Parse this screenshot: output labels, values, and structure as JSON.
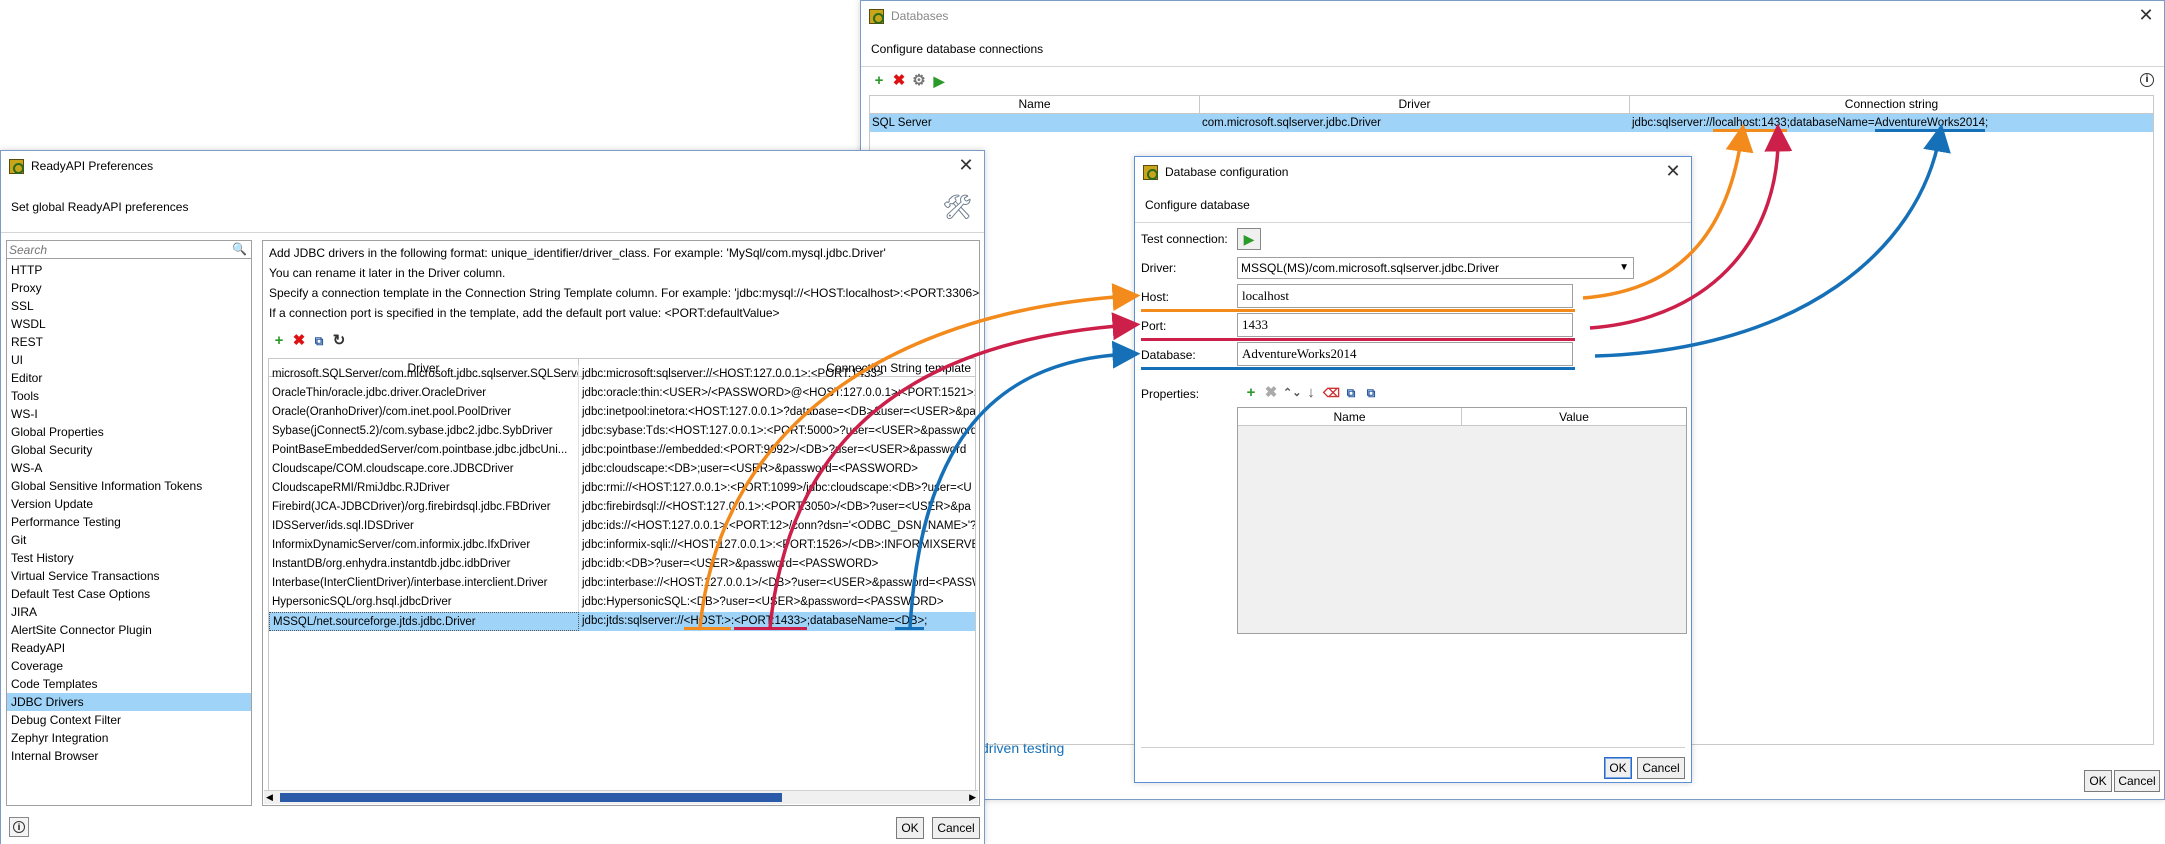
{
  "colors": {
    "orange": "#f28a1c",
    "red": "#cc1f4a",
    "blue": "#1570b8",
    "selection": "#9fd3f8"
  },
  "databases": {
    "title": "Databases",
    "subtitle": "Configure database connections",
    "columns": [
      "Name",
      "Driver",
      "Connection string"
    ],
    "row": {
      "name": "SQL Server",
      "driver": "com.microsoft.sqlserver.jdbc.Driver",
      "conn_prefix": "jdbc:sqlserver://",
      "conn_host_port": "localhost:1433",
      "conn_mid": ";databaseName=",
      "conn_db": "AdventureWorks2014",
      "conn_end": ";"
    },
    "link_text": "driven testing",
    "ok": "OK",
    "cancel": "Cancel"
  },
  "preferences": {
    "title": "ReadyAPI Preferences",
    "subtitle": "Set global ReadyAPI preferences",
    "search_placeholder": "Search",
    "nav": [
      "HTTP",
      "Proxy",
      "SSL",
      "WSDL",
      "REST",
      "UI",
      "Editor",
      "Tools",
      "WS-I",
      "Global Properties",
      "Global Security",
      "WS-A",
      "Global Sensitive Information Tokens",
      "Version Update",
      "Performance Testing",
      "Git",
      "Test History",
      "Virtual Service Transactions",
      "Default Test Case Options",
      "JIRA",
      "AlertSite Connector Plugin",
      "ReadyAPI",
      "Coverage",
      "Code Templates",
      "JDBC Drivers",
      "Debug Context Filter",
      "Zephyr Integration",
      "Internal Browser"
    ],
    "selected_nav": "JDBC Drivers",
    "help": [
      "Add JDBC drivers in the following format: unique_identifier/driver_class. For example: 'MySql/com.mysql.jdbc.Driver'",
      "You can rename it later in the Driver column.",
      "Specify a connection template in the Connection String Template column. For example: 'jdbc:mysql://<HOST:localhost>:<PORT:3306>/",
      "If a connection port is specified in the template, add the default port value: <PORT:defaultValue>"
    ],
    "columns": [
      "Driver",
      "Connection String template"
    ],
    "rows": [
      {
        "d": "microsoft.SQLServer/com.microsoft.jdbc.sqlserver.SQLServerDriver",
        "t": "jdbc:microsoft:sqlserver://<HOST:127.0.0.1>:<PORT:1433>"
      },
      {
        "d": "OracleThin/oracle.jdbc.driver.OracleDriver",
        "t": "jdbc:oracle:thin:<USER>/<PASSWORD>@<HOST:127.0.0.1>:<PORT:1521>:<"
      },
      {
        "d": "Oracle(OranhoDriver)/com.inet.pool.PoolDriver",
        "t": "jdbc:inetpool:inetora:<HOST:127.0.0.1>?database=<DB>&user=<USER>&pa"
      },
      {
        "d": "Sybase(jConnect5.2)/com.sybase.jdbc2.jdbc.SybDriver",
        "t": "jdbc:sybase:Tds:<HOST:127.0.0.1>:<PORT:5000>?user=<USER>&password="
      },
      {
        "d": "PointBaseEmbeddedServer/com.pointbase.jdbc.jdbcUni...",
        "t": "jdbc:pointbase://embedded:<PORT:9092>/<DB>?user=<USER>&password"
      },
      {
        "d": "Cloudscape/COM.cloudscape.core.JDBCDriver",
        "t": "jdbc:cloudscape:<DB>;user=<USER>&password=<PASSWORD>"
      },
      {
        "d": "CloudscapeRMI/RmiJdbc.RJDriver",
        "t": "jdbc:rmi://<HOST:127.0.0.1>:<PORT:1099>/jdbc:cloudscape:<DB>?user=<U"
      },
      {
        "d": "Firebird(JCA-JDBCDriver)/org.firebirdsql.jdbc.FBDriver",
        "t": "jdbc:firebirdsql://<HOST:127.0.0.1>:<PORT:3050>/<DB>?user=<USER>&pa"
      },
      {
        "d": "IDSServer/ids.sql.IDSDriver",
        "t": "jdbc:ids://<HOST:127.0.0.1>:<PORT:12>/conn?dsn='<ODBC_DSN_NAME>'?"
      },
      {
        "d": "InformixDynamicServer/com.informix.jdbc.IfxDriver",
        "t": "jdbc:informix-sqli://<HOST:127.0.0.1>:<PORT:1526>/<DB>:INFORMIXSERVE"
      },
      {
        "d": "InstantDB/org.enhydra.instantdb.jdbc.idbDriver",
        "t": "jdbc:idb:<DB>?user=<USER>&password=<PASSWORD>"
      },
      {
        "d": "Interbase(InterClientDriver)/interbase.interclient.Driver",
        "t": "jdbc:interbase://<HOST:127.0.0.1>/<DB>?user=<USER>&password=<PASSW"
      },
      {
        "d": "HypersonicSQL/org.hsql.jdbcDriver",
        "t": "jdbc:HypersonicSQL:<DB>?user=<USER>&password=<PASSWORD>"
      }
    ],
    "selected_row": {
      "d": "MSSQL/net.sourceforge.jtds.jdbc.Driver",
      "t_prefix": "jdbc:jtds:sqlserver://",
      "t_host": "<HOST:>",
      "t_colon": ":",
      "t_port": "<PORT:1433>",
      "t_mid": ";databaseName=",
      "t_db": "<DB>",
      "t_end": ";"
    },
    "ok": "OK",
    "cancel": "Cancel"
  },
  "dbconfig": {
    "title": "Database configuration",
    "subtitle": "Configure database",
    "test_label": "Test connection:",
    "driver_label": "Driver:",
    "driver_value": "MSSQL(MS)/com.microsoft.sqlserver.jdbc.Driver",
    "host_label": "Host:",
    "host_value": "localhost",
    "port_label": "Port:",
    "port_value": "1433",
    "database_label": "Database:",
    "database_value": "AdventureWorks2014",
    "properties_label": "Properties:",
    "prop_columns": [
      "Name",
      "Value"
    ],
    "ok": "OK",
    "cancel": "Cancel"
  }
}
